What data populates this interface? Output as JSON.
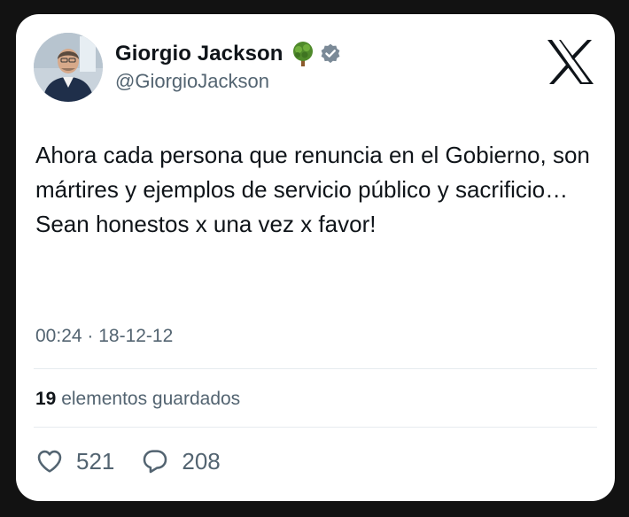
{
  "tweet": {
    "author_name": "Giorgio Jackson",
    "author_handle": "@GiorgioJackson",
    "text": "Ahora cada persona que renuncia en el Gobierno, son mártires y ejemplos de servicio público y sacrificio… Sean honestos x una vez x favor!",
    "timestamp": "00:24 · 18-12-12",
    "saved_count": "19",
    "saved_label": "elementos guardados",
    "likes": "521",
    "replies": "208"
  },
  "icons": {
    "name_emoji": "tree-icon",
    "badge": "verified-badge-icon",
    "brand": "x-logo-icon",
    "like": "heart-icon",
    "reply": "comment-icon"
  },
  "colors": {
    "text_primary": "#0f1419",
    "text_secondary": "#536471",
    "verified_badge": "#7b8a97",
    "tree": "#4f8a2b"
  }
}
